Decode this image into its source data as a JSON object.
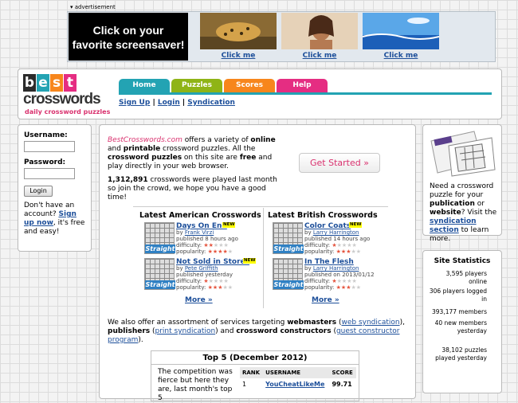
{
  "ad": {
    "label": "▾ advertisement",
    "headline_line1": "Click on your",
    "headline_line2": "favorite screensaver!",
    "links": [
      "Click me",
      "Click me",
      "Click me"
    ]
  },
  "logo": {
    "letters": [
      "b",
      "e",
      "s",
      "t"
    ],
    "word": "crosswords",
    "subtitle": "daily crossword puzzles"
  },
  "tabs": [
    {
      "label": "Home",
      "color": "#23a3b3"
    },
    {
      "label": "Puzzles",
      "color": "#8fb416"
    },
    {
      "label": "Scores",
      "color": "#f7861c"
    },
    {
      "label": "Help",
      "color": "#e52d82"
    }
  ],
  "sublinks": {
    "signup": "Sign Up",
    "sep1": " | ",
    "login": "Login",
    "sep2": " | ",
    "syndication": "Syndication"
  },
  "login": {
    "username_label": "Username:",
    "password_label": "Password:",
    "button": "Login",
    "note_pre": "Don't have an account? ",
    "note_link": "Sign up now",
    "note_post": ", it's free and easy!"
  },
  "intro": {
    "site": "BestCrosswords.com",
    "t1": " offers a variety of ",
    "b1": "online",
    "t2": " and ",
    "b2": "printable",
    "t3": " crossword puzzles. All the ",
    "b3": "crossword puzzles",
    "t4": " on this site are ",
    "b4": "free",
    "t5": " and play directly in your web browser."
  },
  "played": {
    "count": "1,312,891",
    "text": " crosswords were played last month so join the crowd, we hope you have a good time!"
  },
  "get_started": "Get Started »",
  "american": {
    "heading": "Latest American Crosswords",
    "puzzles": [
      {
        "title": "Days On End",
        "new": "NEW",
        "by": "by ",
        "author": "Frank Virzi",
        "published": "published 8 hours ago",
        "difficulty_label": "difficulty:",
        "difficulty": 2,
        "popularity_label": "popularity:",
        "popularity": 4
      },
      {
        "title": "Not Sold in Stores",
        "new": "NEW",
        "by": "by ",
        "author": "Pete Griffith",
        "published": "published yesterday",
        "difficulty_label": "difficulty:",
        "difficulty": 1,
        "popularity_label": "popularity:",
        "popularity": 3
      }
    ],
    "more": "More »"
  },
  "british": {
    "heading": "Latest British Crosswords",
    "puzzles": [
      {
        "title": "Color Coats",
        "new": "NEW",
        "by": "by ",
        "author": "Larry Harrington",
        "published": "published 14 hours ago",
        "difficulty_label": "difficulty:",
        "difficulty": 1,
        "popularity_label": "popularity:",
        "popularity": 3
      },
      {
        "title": "In The Flesh",
        "new": "",
        "by": "by ",
        "author": "Larry Harrington",
        "published": "published on 2013/01/12",
        "difficulty_label": "difficulty:",
        "difficulty": 1,
        "popularity_label": "popularity:",
        "popularity": 3
      }
    ],
    "more": "More »"
  },
  "puzzle_badge": "Straight",
  "services": {
    "t1": "We also offer an assortment of services targeting ",
    "b1": "webmasters",
    "t2": " (",
    "l1": "web syndication",
    "t3": "), ",
    "b2": "publishers",
    "t4": " (",
    "l2": "print syndication",
    "t5": ") and ",
    "b3": "crossword constructors",
    "t6": " (",
    "l3": "guest constructor program",
    "t7": ")."
  },
  "top5": {
    "title": "Top 5 (December 2012)",
    "desc": "The competition was fierce but here they are, last month's top 5",
    "columns": [
      "RANK",
      "USERNAME",
      "SCORE"
    ],
    "rows": [
      {
        "rank": "1",
        "username": "YouCheatLikeMe",
        "score": "99.71"
      }
    ]
  },
  "syndication_promo": {
    "t1": "Need a crossword puzzle for your ",
    "b1": "publication",
    "t2": " or ",
    "b2": "website",
    "t3": "? Visit the ",
    "link": "syndication section",
    "t4": " to learn more."
  },
  "stats": {
    "title": "Site Statistics",
    "items": [
      {
        "value": "3,595",
        "label": "players online"
      },
      {
        "value": "306",
        "label": "players logged in"
      },
      {
        "value": "393,177",
        "label": "members"
      },
      {
        "value": "40",
        "label": "new members yesterday"
      },
      {
        "value": "38,102",
        "label": "puzzles played yesterday"
      }
    ]
  }
}
